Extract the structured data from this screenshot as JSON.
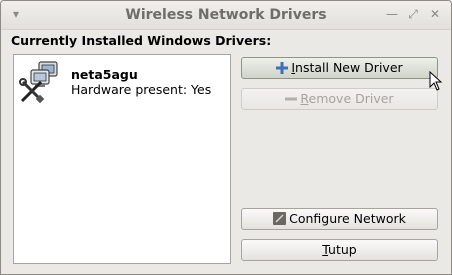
{
  "window": {
    "title": "Wireless Network Drivers",
    "controls": [
      "minimize-icon",
      "maximize-icon",
      "close-icon"
    ]
  },
  "section_label": "Currently Installed Windows Drivers:",
  "drivers": [
    {
      "name": "neta5agu",
      "status": "Hardware present: Yes",
      "icon": "network-hardware-icon"
    }
  ],
  "buttons": {
    "install": {
      "mnemonic": "I",
      "rest": "nstall New Driver",
      "icon": "plus-icon",
      "state": "hover"
    },
    "remove": {
      "mnemonic": "R",
      "rest": "emove Driver",
      "icon": "minus-icon",
      "state": "disabled"
    },
    "configure": {
      "label": "Configure Network",
      "icon": "network-config-icon"
    },
    "close": {
      "mnemonic": "T",
      "rest": "utup"
    }
  }
}
